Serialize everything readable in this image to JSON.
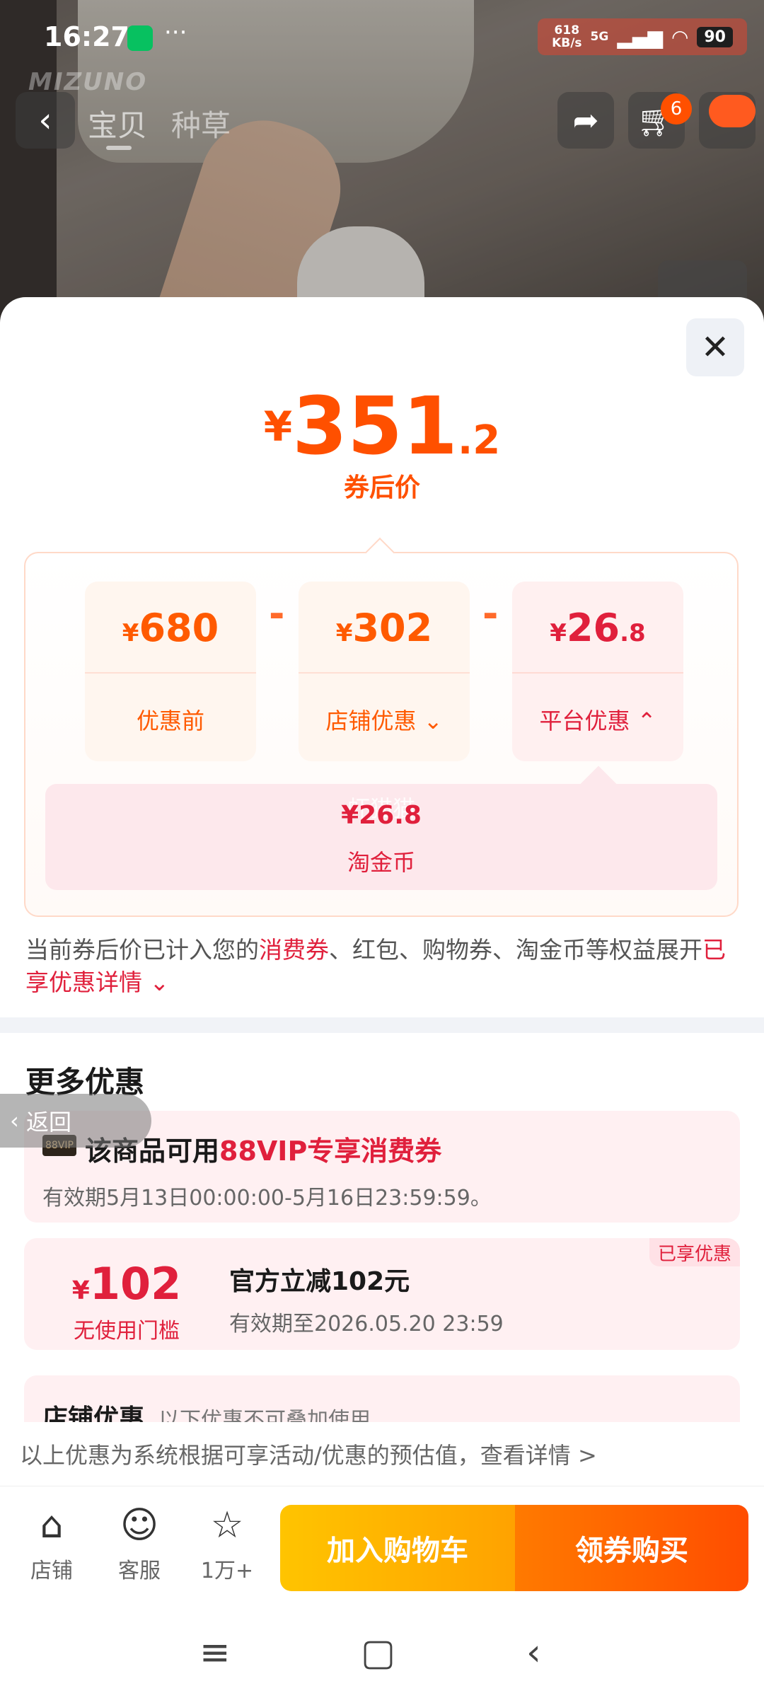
{
  "status_bar": {
    "time": "16:27",
    "dots": "···",
    "net_speed_top": "618",
    "net_speed_bottom": "KB/s",
    "network": "5G",
    "battery": "90"
  },
  "brand_logo": "MIZUNO",
  "nav": {
    "back_icon": "chevron-left-icon",
    "tabs": [
      "宝贝",
      "种草"
    ],
    "cart_badge": "6",
    "share_icon": "share-icon",
    "cart_icon": "cart-icon"
  },
  "sheet": {
    "close_symbol": "✕",
    "final_price": {
      "currency": "¥",
      "integer": "351",
      "decimal": ".2"
    },
    "final_price_label": "券后价",
    "breakdown": {
      "original": {
        "currency": "¥",
        "integer": "680",
        "decimal": "",
        "label": "优惠前"
      },
      "shop": {
        "currency": "¥",
        "integer": "302",
        "decimal": "",
        "label": "店铺优惠"
      },
      "platform": {
        "currency": "¥",
        "integer": "26",
        "decimal": ".8",
        "label": "平台优惠"
      },
      "minus": "-",
      "coin": {
        "amount": "¥26.8",
        "label": "淘金币",
        "watermark": "虾猫猫"
      }
    },
    "note": {
      "part1": "当前券后价已计入您的",
      "hl1": "消费券",
      "part2": "、红包、购物券、淘金币等权益展开",
      "hl2": "已享优惠详情"
    },
    "more_title": "更多优惠",
    "promo_vip": {
      "badge": "88VIP",
      "title_prefix": "该商品可用",
      "title_hl": "88VIP专享消费券",
      "validity": "有效期5月13日00:00:00-5月16日23:59:59。"
    },
    "promo_official": {
      "currency": "¥",
      "amount": "102",
      "condition": "无使用门槛",
      "title": "官方立减102元",
      "validity": "有效期至2026.05.20 23:59",
      "tag": "已享优惠"
    },
    "promo_shop": {
      "title": "店铺优惠",
      "subtitle": "以下优惠不可叠加使用"
    }
  },
  "disclaimer": "以上优惠为系统根据可享活动/优惠的预估值，查看详情 >",
  "return_pill": "返回",
  "action_bar": {
    "store": "店铺",
    "service": "客服",
    "favorite": "1万+",
    "add_to_cart": "加入购物车",
    "buy_with_coupon": "领券购买"
  }
}
